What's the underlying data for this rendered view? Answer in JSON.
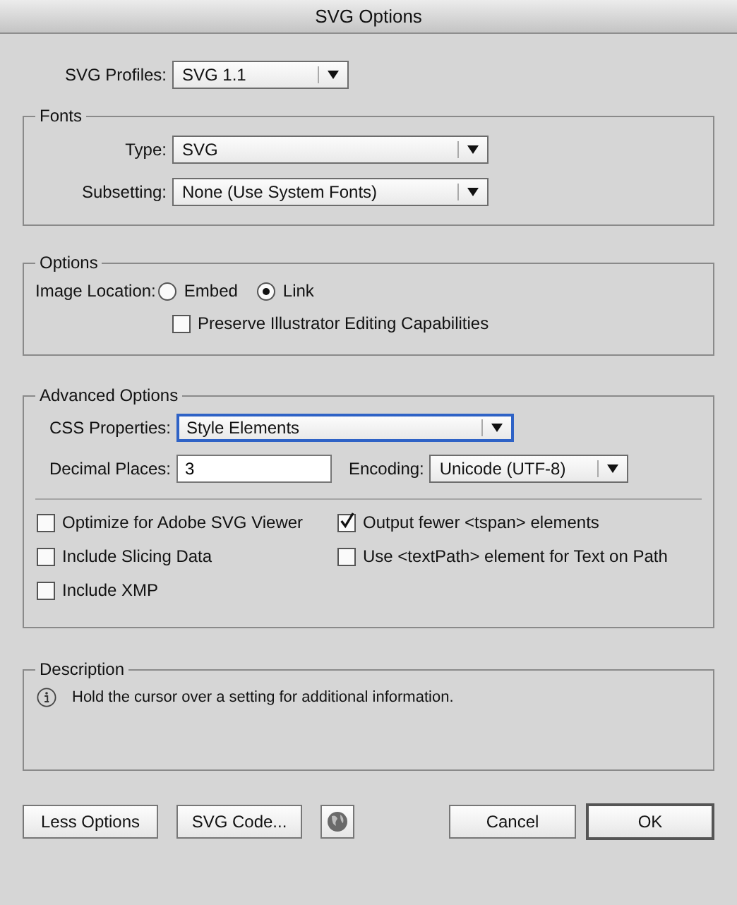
{
  "window": {
    "title": "SVG Options"
  },
  "svg_profiles": {
    "label": "SVG Profiles:",
    "value": "SVG 1.1"
  },
  "fonts": {
    "title": "Fonts",
    "type": {
      "label": "Type:",
      "value": "SVG"
    },
    "subsetting": {
      "label": "Subsetting:",
      "value": "None (Use System Fonts)"
    }
  },
  "options": {
    "title": "Options",
    "image_location": {
      "label": "Image Location:",
      "choices": [
        {
          "label": "Embed",
          "selected": false
        },
        {
          "label": "Link",
          "selected": true
        }
      ]
    },
    "preserve_editing": {
      "label": "Preserve Illustrator Editing Capabilities",
      "checked": false
    }
  },
  "advanced_options": {
    "title": "Advanced Options",
    "css_properties": {
      "label": "CSS Properties:",
      "value": "Style Elements",
      "focused": true
    },
    "decimal_places": {
      "label": "Decimal Places:",
      "value": "3"
    },
    "encoding": {
      "label": "Encoding:",
      "value": "Unicode (UTF-8)"
    },
    "checkboxes": [
      {
        "label": "Optimize for Adobe SVG Viewer",
        "checked": false
      },
      {
        "label": "Output fewer <tspan> elements",
        "checked": true
      },
      {
        "label": "Include Slicing Data",
        "checked": false
      },
      {
        "label": "Use <textPath> element for Text on Path",
        "checked": false
      },
      {
        "label": "Include XMP",
        "checked": false
      }
    ]
  },
  "description": {
    "title": "Description",
    "text": "Hold the cursor over a setting for additional information."
  },
  "left_buttons": [
    {
      "label": "Less Options"
    },
    {
      "label": "SVG Code..."
    }
  ],
  "right_buttons": [
    {
      "label": "Cancel",
      "default": false
    },
    {
      "label": "OK",
      "default": true
    }
  ]
}
